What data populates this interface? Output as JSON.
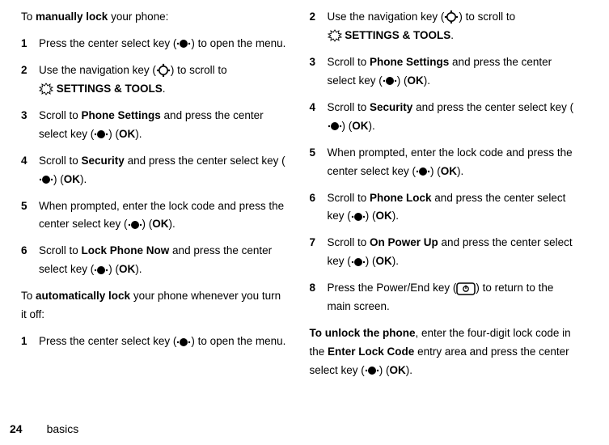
{
  "icons": {
    "center_key": "center-select-key",
    "nav_key": "navigation-key",
    "tools": "settings-tools",
    "end_key": "power-end-key"
  },
  "labels": {
    "ok": "OK",
    "settings_tools": "SETTINGS & TOOLS",
    "phone_settings": "Phone Settings",
    "security": "Security",
    "lock_phone_now": "Lock Phone Now",
    "phone_lock": "Phone Lock",
    "on_power_up": "On Power Up",
    "enter_lock_code": "Enter Lock Code"
  },
  "left": {
    "intro_pre": "To ",
    "intro_bold": "manually lock",
    "intro_post": " your phone:",
    "steps": {
      "s1_a": "Press the center select key (",
      "s1_b": ") to open the menu.",
      "s2_a": "Use the navigation key (",
      "s2_b": ") to scroll to ",
      "s2_c": ".",
      "s3_a": "Scroll to ",
      "s3_b": " and press the center select key (",
      "s3_c": ") (",
      "s3_d": ").",
      "s4_a": "Scroll to ",
      "s4_b": " and press the center select key (",
      "s4_c": ") (",
      "s4_d": ").",
      "s5_a": "When prompted, enter the lock code and press the center select key (",
      "s5_b": ") (",
      "s5_c": ").",
      "s6_a": "Scroll to ",
      "s6_b": " and press the center select key (",
      "s6_c": ") (",
      "s6_d": ")."
    },
    "outro_pre": "To ",
    "outro_bold": "automatically lock",
    "outro_post": " your phone whenever you turn it off:",
    "steps2": {
      "s1_a": "Press the center select key (",
      "s1_b": ") to open the menu."
    }
  },
  "right": {
    "steps": {
      "s2_a": "Use the navigation key (",
      "s2_b": ") to scroll to ",
      "s2_c": ".",
      "s3_a": "Scroll to ",
      "s3_b": " and press the center select key (",
      "s3_c": ") (",
      "s3_d": ").",
      "s4_a": "Scroll to ",
      "s4_b": " and press the center select key (",
      "s4_c": ") (",
      "s4_d": ").",
      "s5_a": "When prompted, enter the lock code and press the center select key (",
      "s5_b": ") (",
      "s5_c": ").",
      "s6_a": "Scroll to ",
      "s6_b": " and press the center select key (",
      "s6_c": ") (",
      "s6_d": ").",
      "s7_a": "Scroll to ",
      "s7_b": " and press the center select key (",
      "s7_c": ") (",
      "s7_d": ").",
      "s8_a": "Press the Power/End key (",
      "s8_b": ") to return to the main screen."
    },
    "unlock_bold": "To unlock the phone",
    "unlock_a": ", enter the four-digit lock code in the ",
    "unlock_b": " entry area and press the center select key (",
    "unlock_c": ") (",
    "unlock_d": ")."
  },
  "footer": {
    "page": "24",
    "section": "basics"
  },
  "numbers": {
    "n1": "1",
    "n2": "2",
    "n3": "3",
    "n4": "4",
    "n5": "5",
    "n6": "6",
    "n7": "7",
    "n8": "8"
  }
}
